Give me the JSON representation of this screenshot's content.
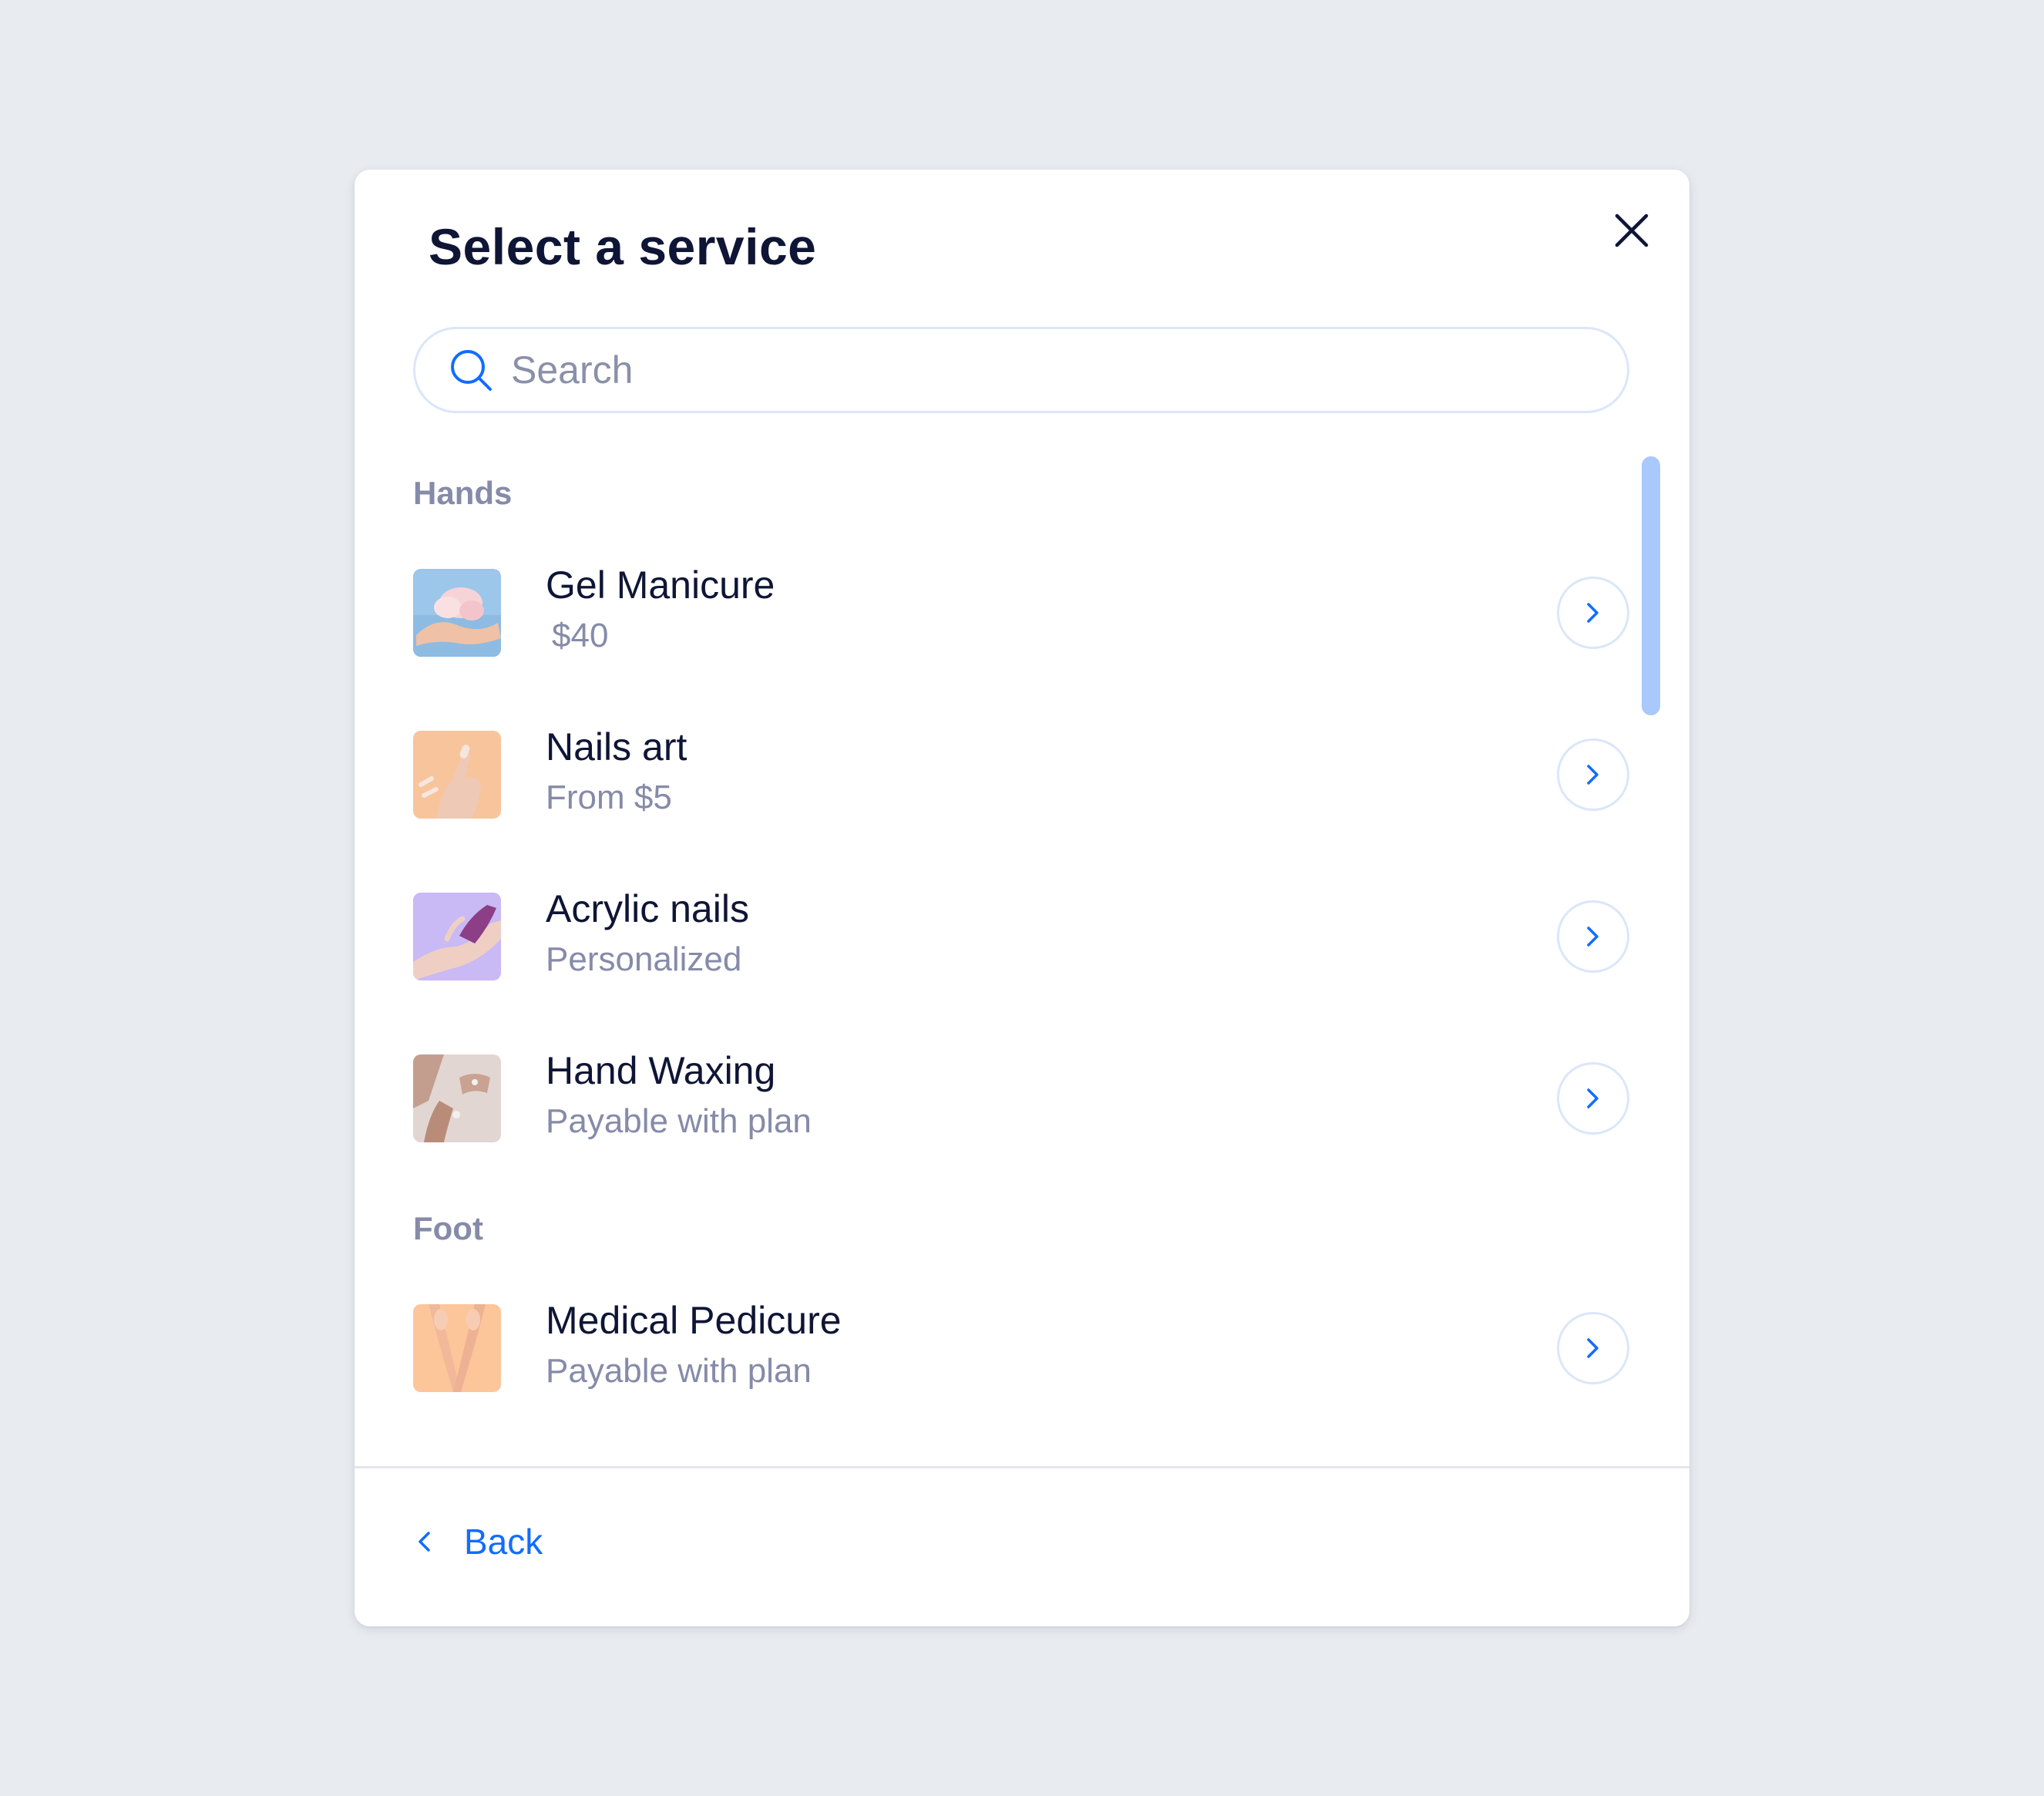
{
  "dialog": {
    "title": "Select a service",
    "close_icon": "close-icon"
  },
  "search": {
    "placeholder": "Search",
    "value": "",
    "icon": "search-icon"
  },
  "categories": [
    {
      "label": "Hands",
      "services": [
        {
          "name": "Gel Manicure",
          "detail": "$40",
          "thumb_color": "#9CC6EA"
        },
        {
          "name": "Nails art",
          "detail": "From $5",
          "thumb_color": "#F8C49C"
        },
        {
          "name": "Acrylic nails",
          "detail": "Personalized",
          "thumb_color": "#C9B9F4"
        },
        {
          "name": "Hand Waxing",
          "detail": "Payable with plan",
          "thumb_color": "#D8C6C2"
        }
      ]
    },
    {
      "label": "Foot",
      "services": [
        {
          "name": "Medical Pedicure",
          "detail": "Payable with plan",
          "thumb_color": "#FDC69A"
        }
      ]
    }
  ],
  "footer": {
    "back_label": "Back",
    "back_icon": "chevron-left-icon"
  },
  "colors": {
    "accent": "#116DFF",
    "title": "#0F1535",
    "muted": "#858BA8",
    "border": "#DBE6FA",
    "background": "#E8EBF0",
    "scrollbar": "#A9C8FB"
  }
}
